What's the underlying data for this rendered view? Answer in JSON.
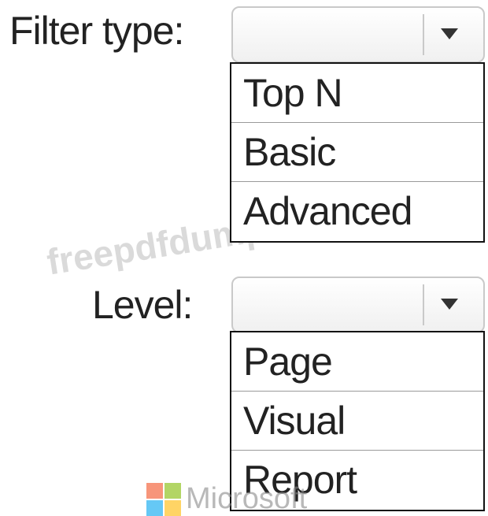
{
  "filter_type": {
    "label": "Filter type:",
    "selected": "",
    "options": [
      "Top N",
      "Basic",
      "Advanced"
    ]
  },
  "level": {
    "label": "Level:",
    "selected": "",
    "options": [
      "Page",
      "Visual",
      "Report"
    ]
  },
  "watermark": {
    "text": "freepdfdumps.com"
  },
  "logo": {
    "text": "Microsoft",
    "colors": [
      "#f25022",
      "#7fba00",
      "#00a4ef",
      "#ffb900"
    ]
  }
}
